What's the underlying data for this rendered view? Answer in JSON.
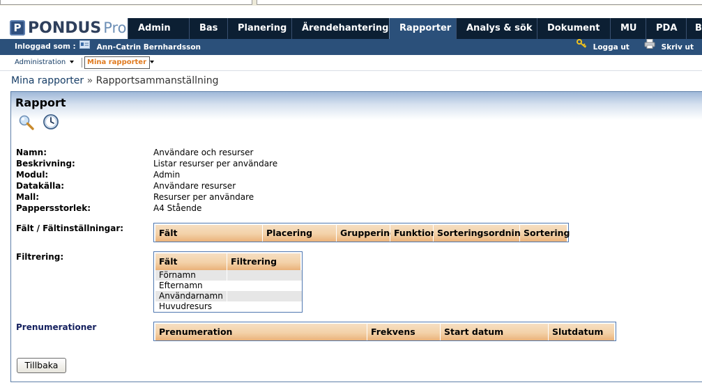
{
  "app": {
    "logo_main": "PONDUS",
    "logo_pro": "Pro",
    "logo_badge": "P"
  },
  "tabs": [
    {
      "label": "Admin"
    },
    {
      "label": "Bas"
    },
    {
      "label": "Planering"
    },
    {
      "label": "Ärendehantering"
    },
    {
      "label": "Rapporter",
      "active": true
    },
    {
      "label": "Analys & sök"
    },
    {
      "label": "Dokument"
    },
    {
      "label": "MU"
    },
    {
      "label": "PDA"
    },
    {
      "label": "Brand"
    }
  ],
  "userbar": {
    "logged_in_label": "Inloggad som :",
    "user_name": "Ann-Catrin Bernhardsson",
    "logout": "Logga ut",
    "print": "Skriv ut"
  },
  "subnav": {
    "administration": "Administration",
    "my_reports": "Mina rapporter"
  },
  "breadcrumb": {
    "parent": "Mina rapporter",
    "separator": "»",
    "current": "Rapportsammanställning"
  },
  "panel": {
    "title": "Rapport"
  },
  "details": [
    {
      "label": "Namn:",
      "value": "Användare och resurser"
    },
    {
      "label": "Beskrivning:",
      "value": "Listar resurser per användare"
    },
    {
      "label": "Modul:",
      "value": "Admin"
    },
    {
      "label": "Datakälla:",
      "value": "Användare resurser"
    },
    {
      "label": "Mall:",
      "value": "Resurser per användare"
    },
    {
      "label": "Pappersstorlek:",
      "value": "A4 Stående"
    }
  ],
  "fields_section": {
    "label": "Fält / Fältinställningar:",
    "headers": [
      "Fält",
      "Placering",
      "Gruppering",
      "Funktion",
      "Sorteringsordning",
      "Sortering"
    ]
  },
  "filter_section": {
    "label": "Filtrering:",
    "headers": [
      "Fält",
      "Filtrering"
    ],
    "rows": [
      "Förnamn",
      "Efternamn",
      "Användarnamn",
      "Huvudresurs"
    ]
  },
  "subscriptions_section": {
    "label": "Prenumerationer",
    "headers": [
      "Prenumeration",
      "Frekvens",
      "Start datum",
      "Slutdatum"
    ]
  },
  "buttons": {
    "back": "Tillbaka"
  },
  "colors": {
    "nav_dark": "#0c1f33",
    "nav_active": "#2b507a",
    "header_orange": "#f3d1a8",
    "grid_border": "#4f77b0",
    "subnav_orange": "#e07a1f"
  }
}
